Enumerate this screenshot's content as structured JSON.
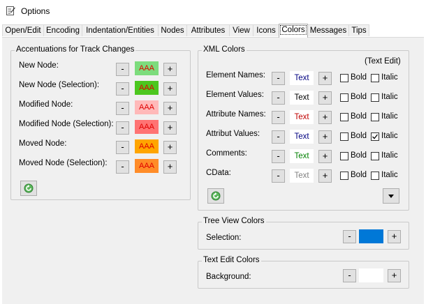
{
  "window": {
    "title": "Options"
  },
  "tabs": [
    {
      "label": "Open/Edit"
    },
    {
      "label": "Encoding"
    },
    {
      "label": "Indentation/Entities"
    },
    {
      "label": "Nodes"
    },
    {
      "label": "Attributes"
    },
    {
      "label": "View"
    },
    {
      "label": "Icons"
    },
    {
      "label": "Colors",
      "active": true
    },
    {
      "label": "Messages"
    },
    {
      "label": "Tips"
    }
  ],
  "track_changes": {
    "title": "Accentuations for Track Changes",
    "minus": "-",
    "plus": "+",
    "rows": [
      {
        "label": "New Node:",
        "sample": "AAA",
        "color": "#7ddc7d"
      },
      {
        "label": "New Node (Selection):",
        "sample": "AAA",
        "color": "#4cc71f"
      },
      {
        "label": "Modified Node:",
        "sample": "AAA",
        "color": "#ffb9b9"
      },
      {
        "label": "Modified Node (Selection):",
        "sample": "AAA",
        "color": "#ff7373"
      },
      {
        "label": "Moved Node:",
        "sample": "AAA",
        "color": "#ffa500"
      },
      {
        "label": "Moved Node (Selection):",
        "sample": "AAA",
        "color": "#ff8c28"
      }
    ]
  },
  "xml_colors": {
    "title": "XML Colors",
    "subtitle": "(Text Edit)",
    "minus": "-",
    "plus": "+",
    "bold_label": "Bold",
    "italic_label": "Italic",
    "rows": [
      {
        "label": "Element Names:",
        "sample": "Text",
        "color": "#000080",
        "bold": false,
        "italic": false
      },
      {
        "label": "Element Values:",
        "sample": "Text",
        "color": "#000000",
        "bold": false,
        "italic": false
      },
      {
        "label": "Attribute Names:",
        "sample": "Text",
        "color": "#c00000",
        "bold": false,
        "italic": false
      },
      {
        "label": "Attribut Values:",
        "sample": "Text",
        "color": "#000080",
        "bold": false,
        "italic": true
      },
      {
        "label": "Comments:",
        "sample": "Text",
        "color": "#008000",
        "bold": false,
        "italic": false
      },
      {
        "label": "CData:",
        "sample": "Text",
        "color": "#808080",
        "bold": false,
        "italic": false
      }
    ]
  },
  "tree_view": {
    "title": "Tree View Colors",
    "label": "Selection:",
    "color": "#0078d7",
    "minus": "-",
    "plus": "+"
  },
  "text_edit": {
    "title": "Text Edit Colors",
    "label": "Background:",
    "color": "#ffffff",
    "minus": "-",
    "plus": "+"
  }
}
